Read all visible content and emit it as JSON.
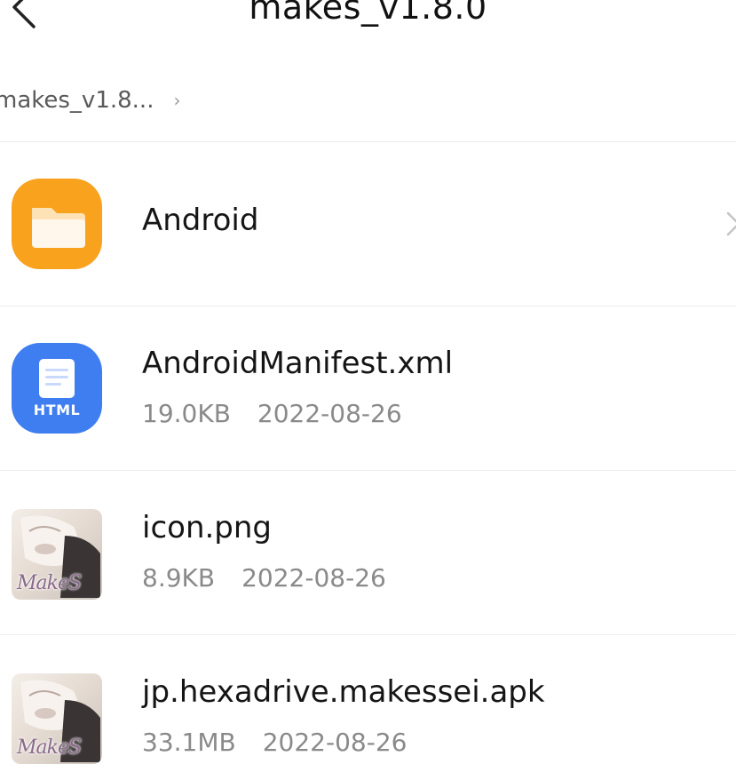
{
  "header": {
    "title": "makes_v1.8.0",
    "back_icon": "chevron-left-icon"
  },
  "breadcrumb": {
    "label": "makes_v1.8...",
    "chevron": "›"
  },
  "files": [
    {
      "name": "Android",
      "type": "folder",
      "icon": "folder-icon",
      "icon_color": "#f8a21d",
      "size": "",
      "date": ""
    },
    {
      "name": "AndroidManifest.xml",
      "type": "html",
      "icon": "html-file-icon",
      "icon_label": "HTML",
      "icon_color": "#3f7ef0",
      "size": "19.0KB",
      "date": "2022-08-26"
    },
    {
      "name": "icon.png",
      "type": "image",
      "icon": "image-thumbnail",
      "thumb_text": "MakeS",
      "size": "8.9KB",
      "date": "2022-08-26"
    },
    {
      "name": "jp.hexadrive.makessei.apk",
      "type": "apk",
      "icon": "apk-thumbnail",
      "thumb_text": "MakeS",
      "size": "33.1MB",
      "date": "2022-08-26"
    }
  ]
}
